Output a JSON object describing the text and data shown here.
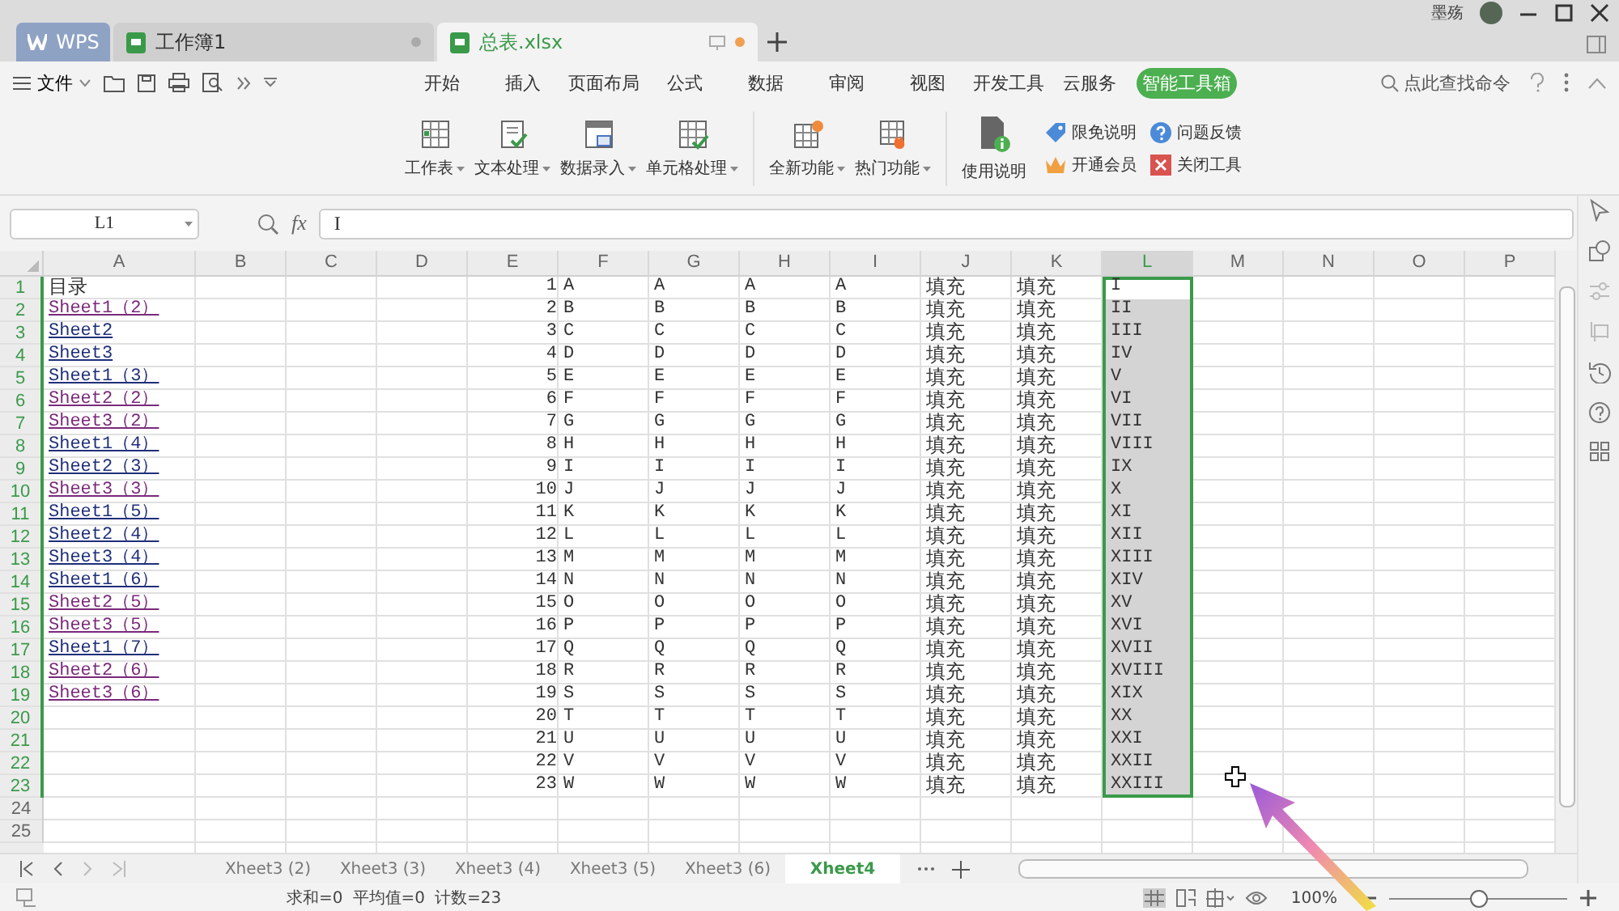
{
  "title_bar": {
    "tabs": [
      {
        "label": "WPS",
        "kind": "app",
        "selected": false
      },
      {
        "label": "工作簿1",
        "kind": "doc",
        "selected": false
      },
      {
        "label": "总表.xlsx",
        "kind": "doc",
        "selected": true
      }
    ],
    "user_name": "墨殇"
  },
  "menu": {
    "file": "文件",
    "tabs": [
      {
        "label": "开始",
        "selected": false
      },
      {
        "label": "插入",
        "selected": false
      },
      {
        "label": "页面布局",
        "selected": false
      },
      {
        "label": "公式",
        "selected": false
      },
      {
        "label": "数据",
        "selected": false
      },
      {
        "label": "审阅",
        "selected": false
      },
      {
        "label": "视图",
        "selected": false
      },
      {
        "label": "开发工具",
        "selected": false
      },
      {
        "label": "云服务",
        "selected": false
      },
      {
        "label": "智能工具箱",
        "selected": true
      }
    ],
    "search": "点此查找命令"
  },
  "ribbon": {
    "groups": [
      {
        "label": "工作表",
        "dropdown": true
      },
      {
        "label": "文本处理",
        "dropdown": true
      },
      {
        "label": "数据录入",
        "dropdown": true
      },
      {
        "label": "单元格处理",
        "dropdown": true
      },
      {
        "label": "全新功能",
        "dropdown": true
      },
      {
        "label": "热门功能",
        "dropdown": true
      },
      {
        "label": "使用说明",
        "dropdown": false
      }
    ],
    "small_items": [
      {
        "label": "限免说明"
      },
      {
        "label": "开通会员"
      },
      {
        "label": "问题反馈"
      },
      {
        "label": "关闭工具"
      }
    ]
  },
  "formula_bar": {
    "cell": "L1",
    "function_label": "fx",
    "value": "I"
  },
  "grid": {
    "columns": [
      {
        "label": "A",
        "selected": false
      },
      {
        "label": "B",
        "selected": false
      },
      {
        "label": "C",
        "selected": false
      },
      {
        "label": "D",
        "selected": false
      },
      {
        "label": "E",
        "selected": false
      },
      {
        "label": "F",
        "selected": false
      },
      {
        "label": "G",
        "selected": false
      },
      {
        "label": "H",
        "selected": false
      },
      {
        "label": "I",
        "selected": false
      },
      {
        "label": "J",
        "selected": false
      },
      {
        "label": "K",
        "selected": false
      },
      {
        "label": "L",
        "selected": true
      },
      {
        "label": "M",
        "selected": false
      },
      {
        "label": "N",
        "selected": false
      },
      {
        "label": "O",
        "selected": false
      },
      {
        "label": "P",
        "selected": false
      }
    ],
    "rows": [
      {
        "number": "1",
        "selected": true,
        "cells": {
          "A": "目录",
          "E": "1",
          "F": "A",
          "G": "A",
          "H": "A",
          "I": "A",
          "J": "填充",
          "K": "填充",
          "L": "I"
        }
      },
      {
        "number": "2",
        "selected": true,
        "cells": {
          "A": {
            "text": "Sheet1（2）",
            "kind": "link",
            "visited": true
          },
          "E": "2",
          "F": "B",
          "G": "B",
          "H": "B",
          "I": "B",
          "J": "填充",
          "K": "填充",
          "L": "II"
        }
      },
      {
        "number": "3",
        "selected": true,
        "cells": {
          "A": {
            "text": "Sheet2",
            "kind": "link",
            "visited": false
          },
          "E": "3",
          "F": "C",
          "G": "C",
          "H": "C",
          "I": "C",
          "J": "填充",
          "K": "填充",
          "L": "III"
        }
      },
      {
        "number": "4",
        "selected": true,
        "cells": {
          "A": {
            "text": "Sheet3",
            "kind": "link",
            "visited": false
          },
          "E": "4",
          "F": "D",
          "G": "D",
          "H": "D",
          "I": "D",
          "J": "填充",
          "K": "填充",
          "L": "IV"
        }
      },
      {
        "number": "5",
        "selected": true,
        "cells": {
          "A": {
            "text": "Sheet1（3）",
            "kind": "link",
            "visited": false
          },
          "E": "5",
          "F": "E",
          "G": "E",
          "H": "E",
          "I": "E",
          "J": "填充",
          "K": "填充",
          "L": "V"
        }
      },
      {
        "number": "6",
        "selected": true,
        "cells": {
          "A": {
            "text": "Sheet2（2）",
            "kind": "link",
            "visited": true
          },
          "E": "6",
          "F": "F",
          "G": "F",
          "H": "F",
          "I": "F",
          "J": "填充",
          "K": "填充",
          "L": "VI"
        }
      },
      {
        "number": "7",
        "selected": true,
        "cells": {
          "A": {
            "text": "Sheet3（2）",
            "kind": "link",
            "visited": true
          },
          "E": "7",
          "F": "G",
          "G": "G",
          "H": "G",
          "I": "G",
          "J": "填充",
          "K": "填充",
          "L": "VII"
        }
      },
      {
        "number": "8",
        "selected": true,
        "cells": {
          "A": {
            "text": "Sheet1（4）",
            "kind": "link",
            "visited": false
          },
          "E": "8",
          "F": "H",
          "G": "H",
          "H": "H",
          "I": "H",
          "J": "填充",
          "K": "填充",
          "L": "VIII"
        }
      },
      {
        "number": "9",
        "selected": true,
        "cells": {
          "A": {
            "text": "Sheet2（3）",
            "kind": "link",
            "visited": false
          },
          "E": "9",
          "F": "I",
          "G": "I",
          "H": "I",
          "I": "I",
          "J": "填充",
          "K": "填充",
          "L": "IX"
        }
      },
      {
        "number": "10",
        "selected": true,
        "cells": {
          "A": {
            "text": "Sheet3（3）",
            "kind": "link",
            "visited": true
          },
          "E": "10",
          "F": "J",
          "G": "J",
          "H": "J",
          "I": "J",
          "J": "填充",
          "K": "填充",
          "L": "X"
        }
      },
      {
        "number": "11",
        "selected": true,
        "cells": {
          "A": {
            "text": "Sheet1（5）",
            "kind": "link",
            "visited": false
          },
          "E": "11",
          "F": "K",
          "G": "K",
          "H": "K",
          "I": "K",
          "J": "填充",
          "K": "填充",
          "L": "XI"
        }
      },
      {
        "number": "12",
        "selected": true,
        "cells": {
          "A": {
            "text": "Sheet2（4）",
            "kind": "link",
            "visited": false
          },
          "E": "12",
          "F": "L",
          "G": "L",
          "H": "L",
          "I": "L",
          "J": "填充",
          "K": "填充",
          "L": "XII"
        }
      },
      {
        "number": "13",
        "selected": true,
        "cells": {
          "A": {
            "text": "Sheet3（4）",
            "kind": "link",
            "visited": false
          },
          "E": "13",
          "F": "M",
          "G": "M",
          "H": "M",
          "I": "M",
          "J": "填充",
          "K": "填充",
          "L": "XIII"
        }
      },
      {
        "number": "14",
        "selected": true,
        "cells": {
          "A": {
            "text": "Sheet1（6）",
            "kind": "link",
            "visited": false
          },
          "E": "14",
          "F": "N",
          "G": "N",
          "H": "N",
          "I": "N",
          "J": "填充",
          "K": "填充",
          "L": "XIV"
        }
      },
      {
        "number": "15",
        "selected": true,
        "cells": {
          "A": {
            "text": "Sheet2（5）",
            "kind": "link",
            "visited": true
          },
          "E": "15",
          "F": "O",
          "G": "O",
          "H": "O",
          "I": "O",
          "J": "填充",
          "K": "填充",
          "L": "XV"
        }
      },
      {
        "number": "16",
        "selected": true,
        "cells": {
          "A": {
            "text": "Sheet3（5）",
            "kind": "link",
            "visited": true
          },
          "E": "16",
          "F": "P",
          "G": "P",
          "H": "P",
          "I": "P",
          "J": "填充",
          "K": "填充",
          "L": "XVI"
        }
      },
      {
        "number": "17",
        "selected": true,
        "cells": {
          "A": {
            "text": "Sheet1（7）",
            "kind": "link",
            "visited": false
          },
          "E": "17",
          "F": "Q",
          "G": "Q",
          "H": "Q",
          "I": "Q",
          "J": "填充",
          "K": "填充",
          "L": "XVII"
        }
      },
      {
        "number": "18",
        "selected": true,
        "cells": {
          "A": {
            "text": "Sheet2（6）",
            "kind": "link",
            "visited": true
          },
          "E": "18",
          "F": "R",
          "G": "R",
          "H": "R",
          "I": "R",
          "J": "填充",
          "K": "填充",
          "L": "XVIII"
        }
      },
      {
        "number": "19",
        "selected": true,
        "cells": {
          "A": {
            "text": "Sheet3（6）",
            "kind": "link",
            "visited": true
          },
          "E": "19",
          "F": "S",
          "G": "S",
          "H": "S",
          "I": "S",
          "J": "填充",
          "K": "填充",
          "L": "XIX"
        }
      },
      {
        "number": "20",
        "selected": true,
        "cells": {
          "E": "20",
          "F": "T",
          "G": "T",
          "H": "T",
          "I": "T",
          "J": "填充",
          "K": "填充",
          "L": "XX"
        }
      },
      {
        "number": "21",
        "selected": true,
        "cells": {
          "E": "21",
          "F": "U",
          "G": "U",
          "H": "U",
          "I": "U",
          "J": "填充",
          "K": "填充",
          "L": "XXI"
        }
      },
      {
        "number": "22",
        "selected": true,
        "cells": {
          "E": "22",
          "F": "V",
          "G": "V",
          "H": "V",
          "I": "V",
          "J": "填充",
          "K": "填充",
          "L": "XXII"
        }
      },
      {
        "number": "23",
        "selected": true,
        "cells": {
          "E": "23",
          "F": "W",
          "G": "W",
          "H": "W",
          "I": "W",
          "J": "填充",
          "K": "填充",
          "L": "XXIII"
        }
      },
      {
        "number": "24",
        "selected": false,
        "cells": {}
      },
      {
        "number": "25",
        "selected": false,
        "cells": {}
      }
    ]
  },
  "sheet_tabs": [
    {
      "label": "Xheet3 (2)",
      "selected": false
    },
    {
      "label": "Xheet3 (3)",
      "selected": false
    },
    {
      "label": "Xheet3 (4)",
      "selected": false
    },
    {
      "label": "Xheet3 (5)",
      "selected": false
    },
    {
      "label": "Xheet3 (6)",
      "selected": false
    },
    {
      "label": "Xheet4",
      "selected": true
    }
  ],
  "status_bar": {
    "sum": "求和=0",
    "average": "平均值=0",
    "count": "计数=23",
    "zoom": "100%",
    "zoom_slider": {
      "level": 0.5
    }
  }
}
